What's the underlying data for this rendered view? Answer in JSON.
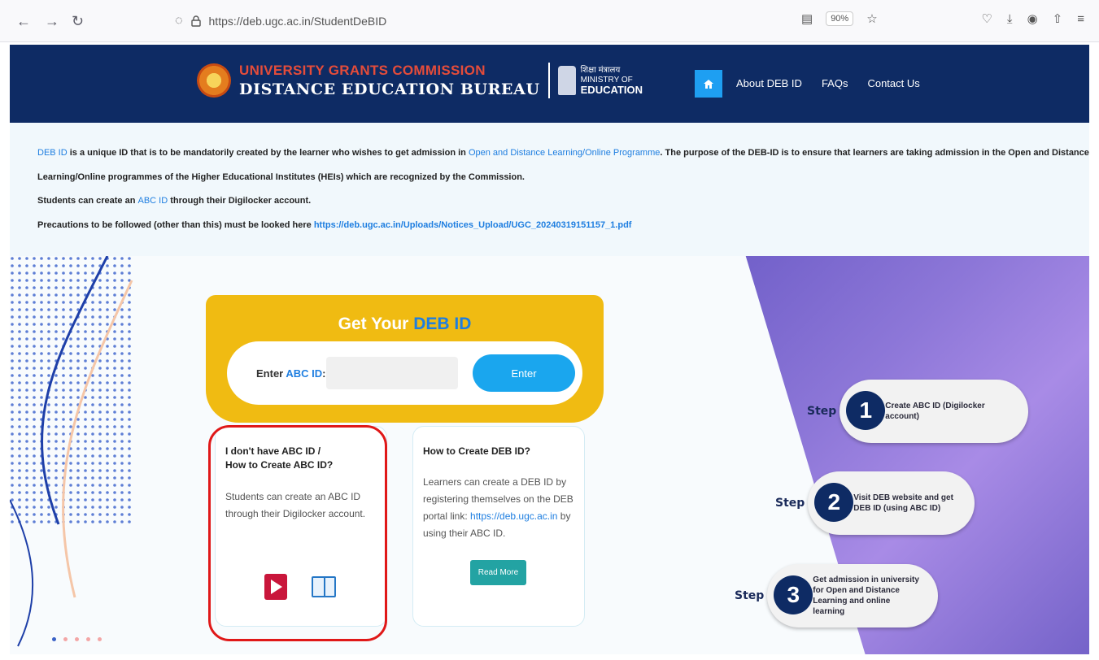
{
  "browser": {
    "url": "https://deb.ugc.ac.in/StudentDeBID",
    "zoom": "90%"
  },
  "header": {
    "org_line1": "UNIVERSITY GRANTS COMMISSION",
    "org_line2": "DISTANCE EDUCATION BUREAU",
    "ministry_hindi": "शिक्षा मंत्रालय",
    "ministry_line1": "MINISTRY OF",
    "ministry_line2": "EDUCATION",
    "menu": [
      "About DEB ID",
      "FAQs",
      "Contact Us"
    ]
  },
  "info": {
    "line1_link1": "DEB ID",
    "line1_text1": " is a unique ID that is to be mandatorily created by the learner who wishes to get admission in ",
    "line1_link2": "Open and Distance Learning/Online Programme",
    "line1_text2": ". The purpose of the DEB-ID is to ensure that learners are taking admission in the Open and Distance",
    "line2": "Learning/Online programmes of the Higher Educational Institutes (HEIs) which are recognized by the Commission.",
    "line3_text1": "Students can create an ",
    "line3_link": "ABC ID",
    "line3_text2": " through their Digilocker account.",
    "line4_text": "Precautions to be followed (other than this) must be looked here ",
    "line4_link": "https://deb.ugc.ac.in/Uploads/Notices_Upload/UGC_20240319151157_1.pdf"
  },
  "get_deb": {
    "title_prefix": "Get Your ",
    "title_highlight": "DEB ID",
    "label_prefix": "Enter ",
    "label_highlight": "ABC ID",
    "label_suffix": ":",
    "input_value": "",
    "input_placeholder": "",
    "enter_label": "Enter"
  },
  "card_abc": {
    "title_line1": "I don't have ABC ID /",
    "title_line2": "How to Create ABC ID?",
    "body_line1": "Students can create an ABC ID",
    "body_line2": "through their Digilocker account."
  },
  "card_deb": {
    "title": "How to Create DEB ID?",
    "body_line1": "Learners can create a DEB ID by",
    "body_line2": "registering themselves on the DEB",
    "body_line3_text": "portal link: ",
    "body_line3_link": "https://deb.ugc.ac.in",
    "body_line3_tail": " by",
    "body_line4": "using their ABC ID.",
    "read_more_label": "Read More"
  },
  "steps": [
    {
      "word": "Step",
      "num": "1",
      "line1": "Create ABC ID (Digilocker account)",
      "line2": "",
      "line3": ""
    },
    {
      "word": "Step",
      "num": "2",
      "line1": "Visit DEB website and get",
      "line2": "DEB ID (using ABC ID)",
      "line3": ""
    },
    {
      "word": "Step",
      "num": "3",
      "line1": "Get admission in university",
      "line2": "for Open and Distance",
      "line3": "Learning and online learning"
    }
  ],
  "colors": {
    "header_bg": "#0e2b64",
    "accent_blue": "#1e9ff2",
    "banner_yellow": "#f0bb12",
    "highlight_red": "#e01818",
    "read_more_teal": "#23a3a3"
  }
}
